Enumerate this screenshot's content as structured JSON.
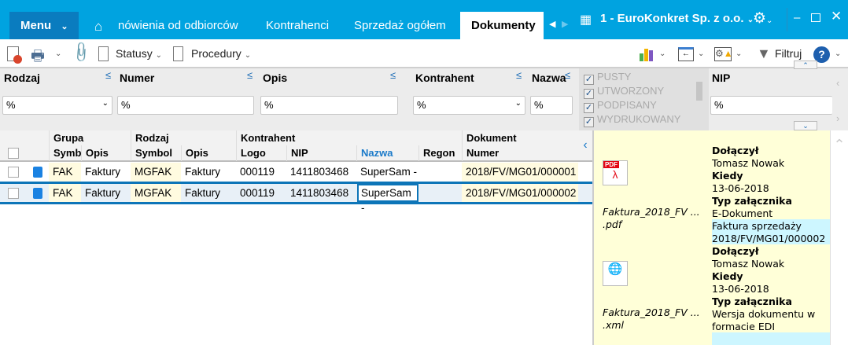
{
  "topbar": {
    "menu": "Menu",
    "tabs": [
      "nówienia od odbiorców",
      "Kontrahenci",
      "Sprzedaż ogółem",
      "Dokumenty"
    ],
    "company": "1 - EuroKonkret Sp. z o.o."
  },
  "toolbar": {
    "statusy": "Statusy",
    "procedury": "Procedury",
    "filtruj": "Filtruj"
  },
  "filters": {
    "rodzaj": {
      "label": "Rodzaj",
      "value": "%"
    },
    "numer": {
      "label": "Numer",
      "value": "%"
    },
    "opis": {
      "label": "Opis",
      "value": "%"
    },
    "kontrahent": {
      "label": "Kontrahent",
      "value": "%"
    },
    "nazwa": {
      "label": "Nazwa",
      "value": "%"
    },
    "statuses": [
      "PUSTY",
      "UTWORZONY",
      "PODPISANY",
      "WYDRUKOWANY"
    ],
    "nip": {
      "label": "NIP",
      "value": "%"
    }
  },
  "grid": {
    "groups": [
      "Grupa",
      "Rodzaj",
      "Kontrahent",
      "Dokument"
    ],
    "columns": [
      "Symb",
      "Opis",
      "Symbol",
      "Opis",
      "Logo",
      "NIP",
      "Nazwa",
      "Regon",
      "Numer"
    ],
    "rows": [
      [
        "FAK",
        "Faktury",
        "MGFAK",
        "Faktury",
        "000119",
        "1411803468",
        "SuperSam -",
        "",
        "2018/FV/MG01/000001"
      ],
      [
        "FAK",
        "Faktury",
        "MGFAK",
        "Faktury",
        "000119",
        "1411803468",
        "SuperSam -",
        "",
        "2018/FV/MG01/000002"
      ]
    ]
  },
  "attachments": [
    {
      "filename": "Faktura_2018_FV ...",
      "ext": ".pdf",
      "l1": "Dołączył",
      "v1": "Tomasz Nowak",
      "l2": "Kiedy",
      "v2": "13-06-2018",
      "l3": "Typ załącznika",
      "v3": "E-Dokument",
      "desc1": "Faktura sprzedaży",
      "desc2": "2018/FV/MG01/000002"
    },
    {
      "filename": "Faktura_2018_FV ...",
      "ext": ".xml",
      "l1": "Dołączył",
      "v1": "Tomasz Nowak",
      "l2": "Kiedy",
      "v2": "13-06-2018",
      "l3": "Typ załącznika",
      "v3a": "Wersja dokumentu w",
      "v3b": "formacie EDI"
    }
  ]
}
